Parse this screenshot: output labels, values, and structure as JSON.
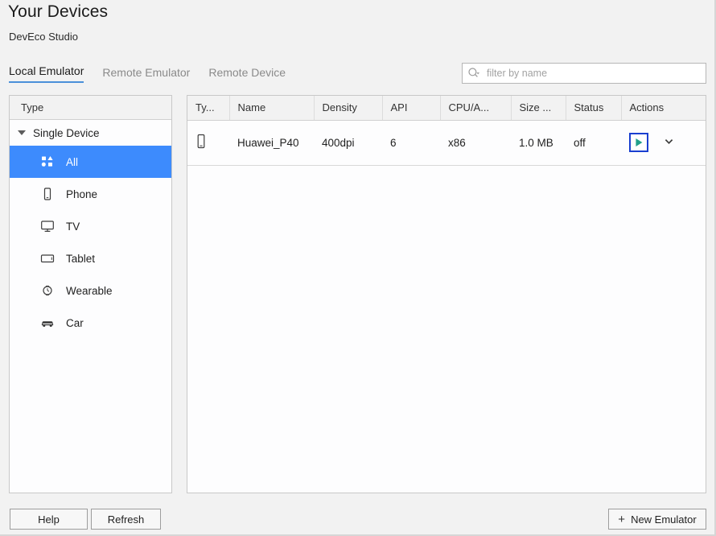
{
  "header": {
    "title": "Your Devices",
    "subtitle": "DevEco Studio"
  },
  "tabs": [
    {
      "label": "Local Emulator",
      "active": true
    },
    {
      "label": "Remote Emulator",
      "active": false
    },
    {
      "label": "Remote Device",
      "active": false
    }
  ],
  "search": {
    "placeholder": "filter by name",
    "value": "",
    "icon": "search-icon"
  },
  "sidebar": {
    "header": "Type",
    "tree_node": "Single Device",
    "items": [
      {
        "label": "All",
        "icon": "all-devices-icon",
        "selected": true
      },
      {
        "label": "Phone",
        "icon": "phone-icon",
        "selected": false
      },
      {
        "label": "TV",
        "icon": "tv-icon",
        "selected": false
      },
      {
        "label": "Tablet",
        "icon": "tablet-icon",
        "selected": false
      },
      {
        "label": "Wearable",
        "icon": "watch-icon",
        "selected": false
      },
      {
        "label": "Car",
        "icon": "car-icon",
        "selected": false
      }
    ]
  },
  "table": {
    "columns": [
      "Ty...",
      "Name",
      "Density",
      "API",
      "CPU/A...",
      "Size ...",
      "Status",
      "Actions"
    ],
    "rows": [
      {
        "type_icon": "phone-icon",
        "name": "Huawei_P40",
        "density": "400dpi",
        "api": "6",
        "cpu": "x86",
        "size": "1.0 MB",
        "status": "off",
        "actions": {
          "run": "run-icon",
          "more": "chevron-down-icon"
        }
      }
    ]
  },
  "footer": {
    "help_label": "Help",
    "refresh_label": "Refresh",
    "new_emulator_label": "New Emulator",
    "new_emulator_plus": "+"
  },
  "colors": {
    "selection_blue": "#3d8bfd",
    "tab_underline": "#4a90d9",
    "link_blue": "#2b2be0",
    "run_green": "#21a08b",
    "focus_border": "#1a3fd0",
    "panel_bg": "#fdfdfe",
    "window_bg": "#f2f2f2"
  }
}
